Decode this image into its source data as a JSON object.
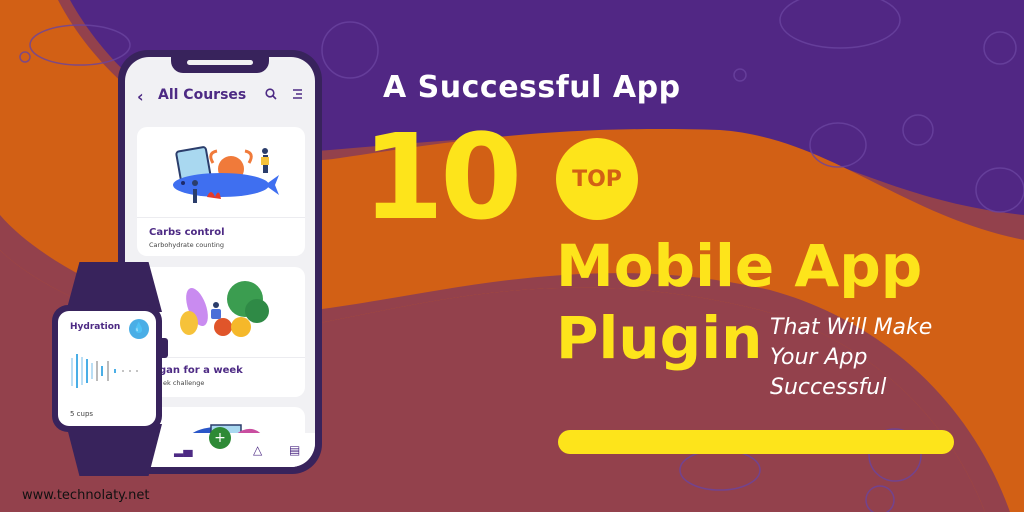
{
  "banner": {
    "kicker": "A Successful App",
    "number": "10",
    "badge": "TOP",
    "headline_line1": "Mobile App",
    "headline_line2": "Plugin",
    "tagline": [
      "That Will Make",
      "Your App",
      "Successful"
    ],
    "website": "www.technolaty.net"
  },
  "colors": {
    "purple": "#512784",
    "orange": "#d26015",
    "maroon": "#93414c",
    "yellow": "#fde41b",
    "device": "#38235c"
  },
  "phone": {
    "header": {
      "back_icon": "chevron-left-icon",
      "title": "All Courses",
      "search_icon": "search-icon",
      "menu_icon": "menu-icon"
    },
    "cards": [
      {
        "title": "Carbs control",
        "subtitle": "Carbohydrate counting"
      },
      {
        "title": "gan for a week",
        "subtitle": "ek challenge"
      },
      {
        "title": "",
        "subtitle": ""
      }
    ],
    "nav": [
      {
        "icon": "grid-icon"
      },
      {
        "icon": "stats-icon"
      },
      {
        "icon": "plus-icon",
        "label": "+"
      },
      {
        "icon": "bell-icon"
      },
      {
        "icon": "profile-icon"
      }
    ]
  },
  "watch": {
    "title": "Hydration",
    "icon": "water-drop-icon",
    "footer": "5 cups"
  }
}
